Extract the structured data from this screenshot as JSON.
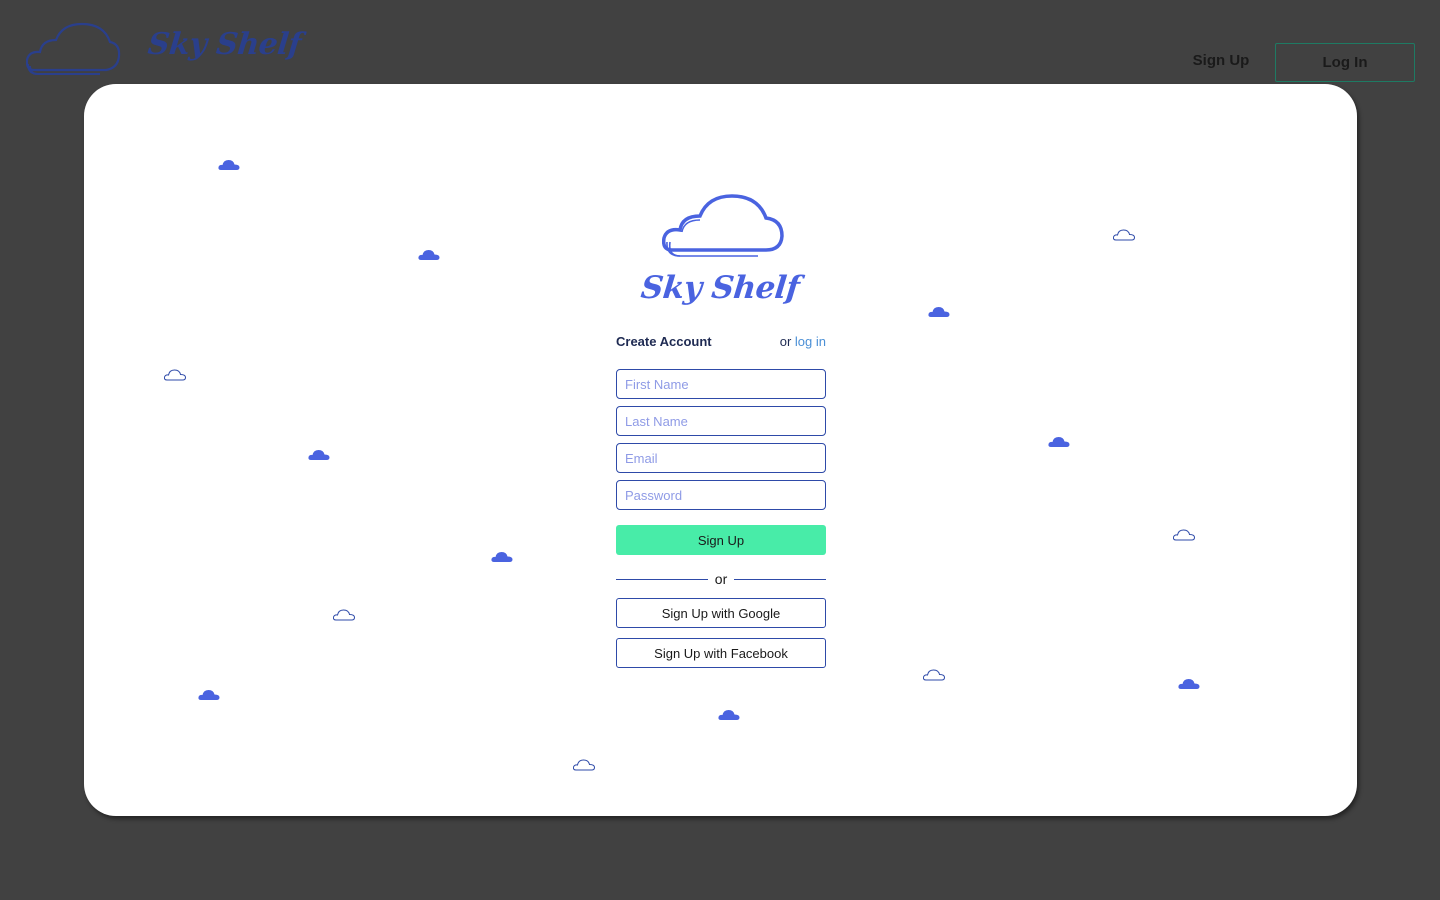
{
  "brand": {
    "name": "Sky Shelf",
    "logo_icon": "cloud-logo-icon",
    "color": "#2a3f8c"
  },
  "nav": {
    "signup_label": "Sign Up",
    "login_label": "Log In"
  },
  "hero": {
    "title": "Sky Shelf",
    "logo_icon": "cloud-logo-icon",
    "accent_color": "#4a63e0"
  },
  "form": {
    "heading": "Create Account",
    "or_prefix": "or",
    "login_link": "log in",
    "fields": {
      "first_name": {
        "placeholder": "First Name",
        "value": ""
      },
      "last_name": {
        "placeholder": "Last Name",
        "value": ""
      },
      "email": {
        "placeholder": "Email",
        "value": ""
      },
      "password": {
        "placeholder": "Password",
        "value": ""
      }
    },
    "submit_label": "Sign Up",
    "divider_text": "or",
    "google_label": "Sign Up with Google",
    "facebook_label": "Sign Up with Facebook"
  },
  "colors": {
    "background": "#414141",
    "card": "#ffffff",
    "primary_button": "#48eca8",
    "outline": "#2e4aa8",
    "link": "#4a8fd6",
    "cloud": "#4a63e0"
  },
  "decor": {
    "icons": [
      "cloud-filled-icon",
      "cloud-outline-icon"
    ]
  }
}
